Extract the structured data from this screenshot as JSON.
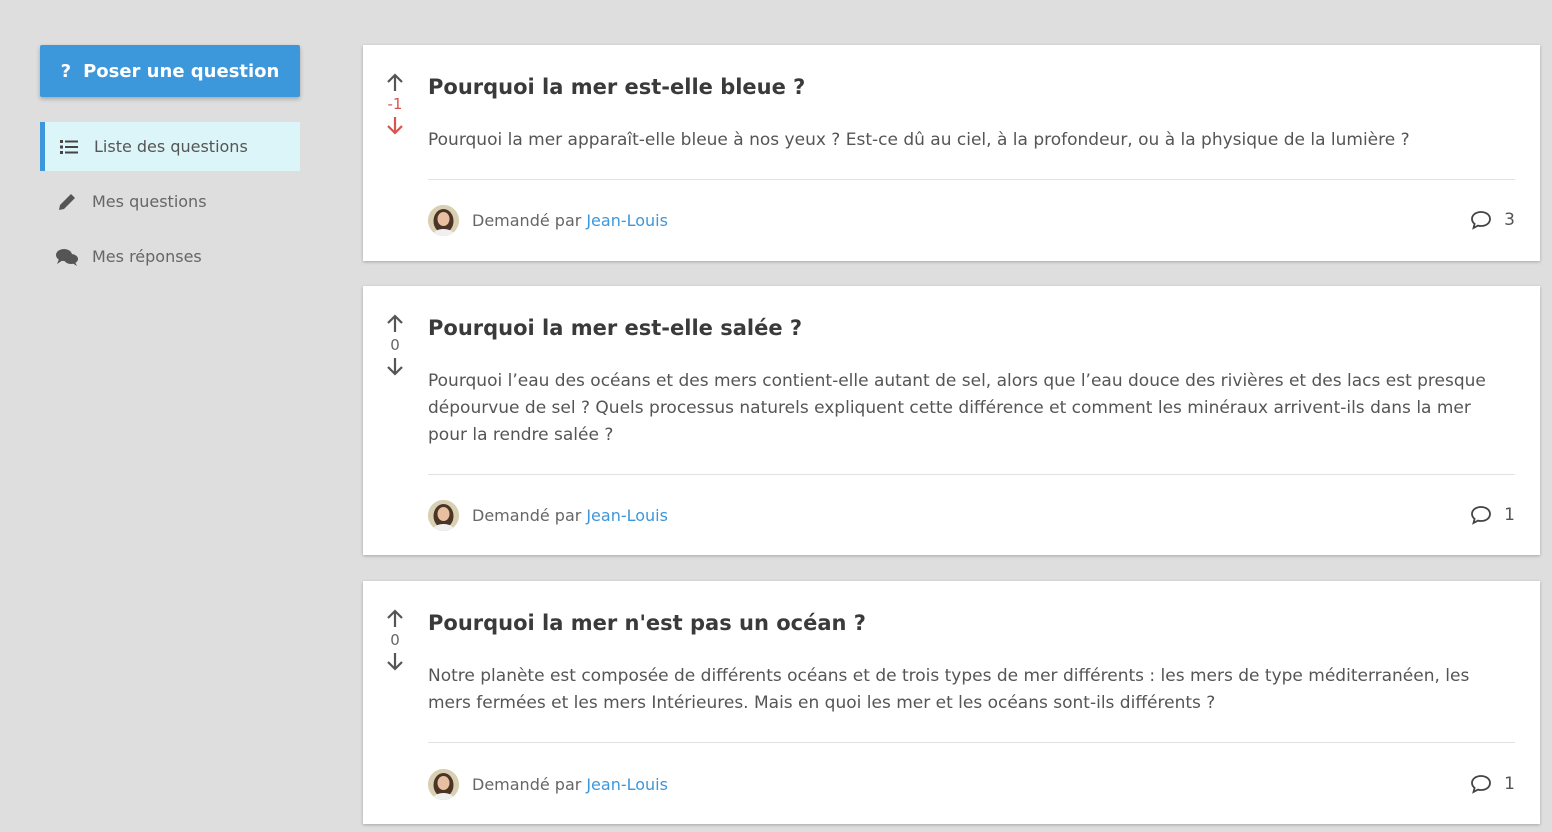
{
  "sidebar": {
    "ask_button": {
      "icon": "question-icon",
      "icon_text": "?",
      "label": "Poser une question"
    },
    "items": [
      {
        "label": "Liste des questions",
        "icon": "list-icon",
        "active": true
      },
      {
        "label": "Mes questions",
        "icon": "pencil-icon",
        "active": false
      },
      {
        "label": "Mes réponses",
        "icon": "comments-icon",
        "active": false
      }
    ]
  },
  "colors": {
    "accent": "#3d97db",
    "active_bg": "#dcf5f8",
    "negative": "#d9534f",
    "background": "#dedede"
  },
  "questions": [
    {
      "score": "-1",
      "title": "Pourquoi la mer est-elle bleue ?",
      "body": "Pourquoi la mer apparaît-elle bleue à nos yeux ? Est-ce dû au ciel, à la profondeur, ou à la physique de la lumière ?",
      "asked_label": "Demandé par",
      "author": "Jean-Louis",
      "comments": "3"
    },
    {
      "score": "0",
      "title": "Pourquoi la mer est-elle salée ?",
      "body": "Pourquoi l’eau des océans et des mers contient-elle autant de sel, alors que l’eau douce des rivières et des lacs est presque dépourvue de sel ? Quels processus naturels expliquent cette différence et comment les minéraux arrivent-ils dans la mer pour la rendre salée ?",
      "asked_label": "Demandé par",
      "author": "Jean-Louis",
      "comments": "1"
    },
    {
      "score": "0",
      "title": "Pourquoi la mer n'est pas un océan ?",
      "body": "Notre planète est composée de différents océans et de trois types de mer différents : les mers de type méditerranéen, les mers fermées et les mers Intérieures. Mais en quoi les mer et les océans sont-ils différents ?",
      "asked_label": "Demandé par",
      "author": "Jean-Louis",
      "comments": "1"
    }
  ]
}
